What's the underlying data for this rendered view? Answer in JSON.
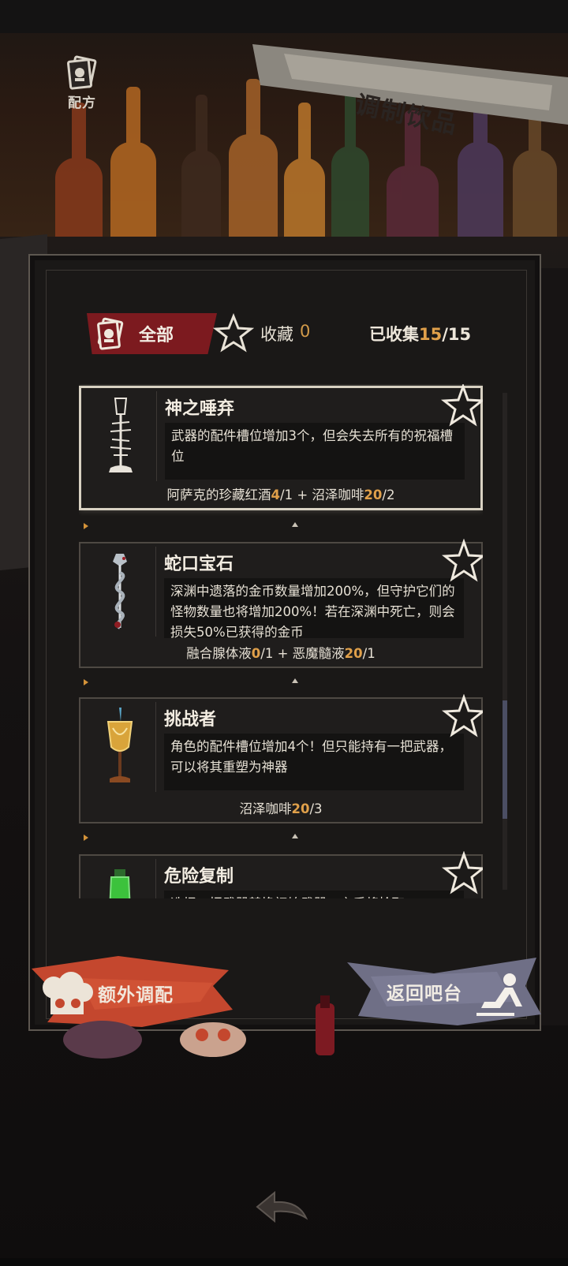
{
  "header": {
    "title": "调制饮品",
    "recipe_label": "配方"
  },
  "filters": {
    "all_label": "全部",
    "favorites_label": "收藏",
    "favorites_count": "0",
    "collected_label": "已收集",
    "collected_current": "15",
    "collected_sep": "/",
    "collected_total": "15"
  },
  "drinks": [
    {
      "name": "神之唾弃",
      "desc": "武器的配件槽位增加3个，但会失去所有的祝福槽位",
      "ingredients": [
        {
          "name": "阿萨克的珍藏红酒",
          "have": "4",
          "need": "1"
        },
        {
          "name": "沼泽咖啡",
          "have": "20",
          "need": "2"
        }
      ]
    },
    {
      "name": "蛇口宝石",
      "desc": "深渊中遗落的金币数量增加200%，但守护它们的怪物数量也将增加200%！若在深渊中死亡，则会损失50%已获得的金币",
      "ingredients": [
        {
          "name": "融合腺体液",
          "have": "0",
          "need": "1"
        },
        {
          "name": "恶魔髓液",
          "have": "20",
          "need": "1"
        }
      ]
    },
    {
      "name": "挑战者",
      "desc": "角色的配件槽位增加4个！但只能持有一把武器，可以将其重塑为神器",
      "ingredients": [
        {
          "name": "沼泽咖啡",
          "have": "20",
          "need": "3"
        }
      ]
    },
    {
      "name": "危险复制",
      "desc": "选择一把武器替换初始武器，之后将拾取",
      "ingredients": []
    }
  ],
  "buttons": {
    "extra_mix": "额外调配",
    "back_to_bar": "返回吧台"
  },
  "colors": {
    "accent_gold": "#e0a04a",
    "tab_active": "#7c1a1f",
    "extra_button": "#c4472e",
    "back_button": "#6f6f86"
  },
  "icons": [
    "recipe-card-icon",
    "star-icon",
    "chef-hat-icon",
    "return-figure-icon",
    "back-arrow-icon"
  ]
}
